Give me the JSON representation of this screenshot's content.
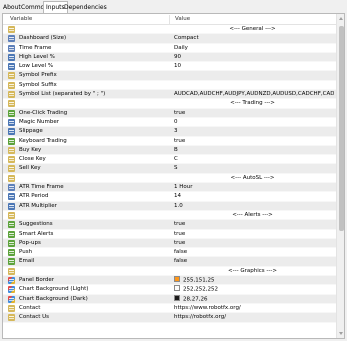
{
  "tabs": [
    "About",
    "Common",
    "Inputs",
    "Dependencies"
  ],
  "table": {
    "columns": [
      "Variable",
      "Value"
    ],
    "rows": [
      {
        "icon": "ab",
        "name": "",
        "value": "<--- General --->",
        "section": true
      },
      {
        "icon": "enum",
        "name": "Dashboard (Size)",
        "value": "Compact"
      },
      {
        "icon": "enum",
        "name": "Time Frame",
        "value": "Daily"
      },
      {
        "icon": "num",
        "name": "High Level %",
        "value": "90"
      },
      {
        "icon": "num",
        "name": "Low Level %",
        "value": "10"
      },
      {
        "icon": "ab",
        "name": "Symbol Prefix",
        "value": ""
      },
      {
        "icon": "ab",
        "name": "Symbol Suffix",
        "value": ""
      },
      {
        "icon": "ab",
        "name": "Symbol List (separated by \" ; \")",
        "value": "AUDCAD,AUDCHF,AUDJPY,AUDNZD,AUDUSD,CADCHF,CADJPY,CHFJ..."
      },
      {
        "icon": "ab",
        "name": "",
        "value": "<--- Trading --->",
        "section": true
      },
      {
        "icon": "bool",
        "name": "One-Click Trading",
        "value": "true"
      },
      {
        "icon": "num",
        "name": "Magic Number",
        "value": "0"
      },
      {
        "icon": "num",
        "name": "Slippage",
        "value": "3"
      },
      {
        "icon": "bool",
        "name": "Keyboard Trading",
        "value": "true"
      },
      {
        "icon": "ab",
        "name": "Buy Key",
        "value": "B"
      },
      {
        "icon": "ab",
        "name": "Close Key",
        "value": "C"
      },
      {
        "icon": "ab",
        "name": "Sell Key",
        "value": "S"
      },
      {
        "icon": "ab",
        "name": "",
        "value": "<--- AutoSL --->",
        "section": true
      },
      {
        "icon": "enum",
        "name": "ATR Time Frame",
        "value": "1 Hour"
      },
      {
        "icon": "num",
        "name": "ATR Period",
        "value": "14"
      },
      {
        "icon": "num",
        "name": "ATR Multiplier",
        "value": "1.0"
      },
      {
        "icon": "ab",
        "name": "",
        "value": "<--- Alerts --->",
        "section": true
      },
      {
        "icon": "bool",
        "name": "Suggestions",
        "value": "true"
      },
      {
        "icon": "bool",
        "name": "Smart Alerts",
        "value": "true"
      },
      {
        "icon": "bool",
        "name": "Pop-ups",
        "value": "true"
      },
      {
        "icon": "bool",
        "name": "Push",
        "value": "false"
      },
      {
        "icon": "bool",
        "name": "Email",
        "value": "false"
      },
      {
        "icon": "ab",
        "name": "",
        "value": "<--- Graphics --->",
        "section": true
      },
      {
        "icon": "color",
        "name": "Panel Border",
        "value": "255,151,25",
        "color": "#ff9719"
      },
      {
        "icon": "color",
        "name": "Chart Background (Light)",
        "value": "252,252,252",
        "color": "#fcfcfc"
      },
      {
        "icon": "color",
        "name": "Chart Background (Dark)",
        "value": "28,27,26",
        "color": "#1c1b1a"
      },
      {
        "icon": "ab",
        "name": "Contact",
        "value": "https://www.robotfx.org/"
      },
      {
        "icon": "ab",
        "name": "Contact Us",
        "value": "https://robotfx.org/"
      }
    ]
  }
}
